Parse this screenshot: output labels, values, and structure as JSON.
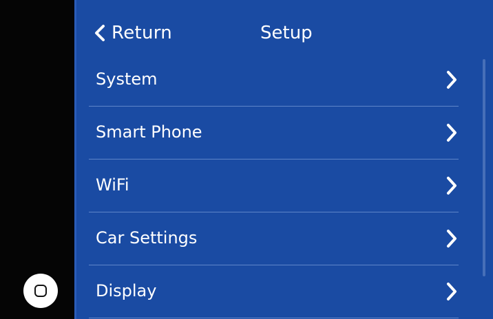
{
  "header": {
    "return_label": "Return",
    "title": "Setup"
  },
  "menu": {
    "items": [
      {
        "label": "System"
      },
      {
        "label": "Smart Phone"
      },
      {
        "label": "WiFi"
      },
      {
        "label": "Car Settings"
      },
      {
        "label": "Display"
      }
    ]
  },
  "icons": {
    "back": "chevron-left-icon",
    "item": "chevron-right-icon",
    "home": "home-icon"
  },
  "colors": {
    "panel_background": "#1a4ba3",
    "divider": "#5f86c9",
    "text": "#ffffff",
    "sidebar_background": "#050505"
  }
}
